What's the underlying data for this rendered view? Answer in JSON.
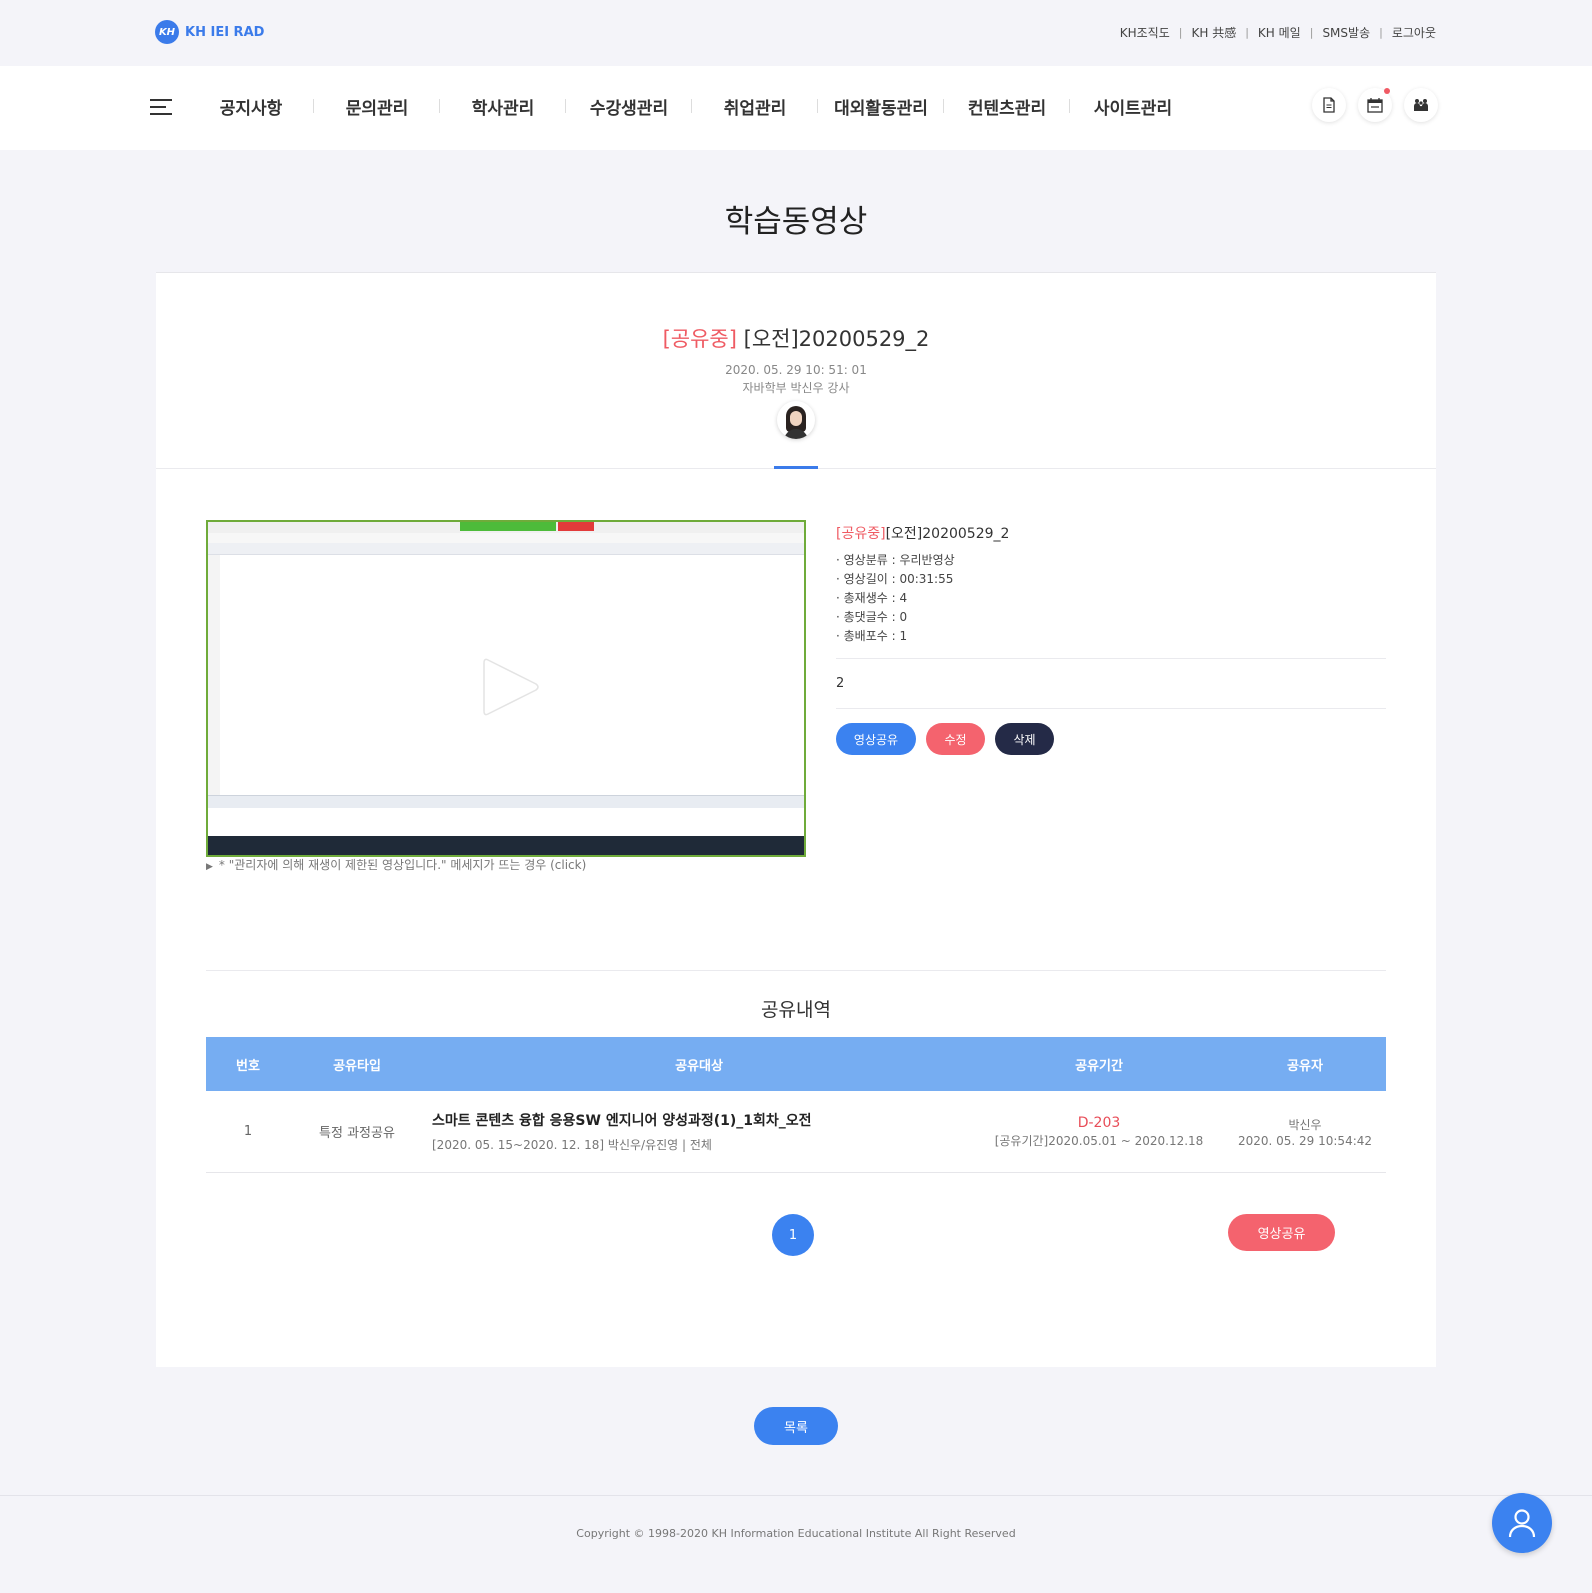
{
  "brand": {
    "logo_mark": "KH",
    "logo_text": "KH IEI RAD",
    "accent": "#3b7bea"
  },
  "util_links": [
    "KH조직도",
    "KH 共感",
    "KH 메일",
    "SMS발송",
    "로그아웃"
  ],
  "nav": {
    "menu": [
      "공지사항",
      "문의관리",
      "학사관리",
      "수강생관리",
      "취업관리",
      "대외활동관리",
      "컨텐츠관리",
      "사이트관리"
    ],
    "icons": [
      "document-icon",
      "calendar-icon",
      "people-icon"
    ]
  },
  "page": {
    "title": "학습동영상"
  },
  "video": {
    "status_tag": "[공유중]",
    "title": "[오전]20200529_2",
    "datetime": "2020. 05. 29 10: 51: 01",
    "author": "자바학부 박신우 강사",
    "restrict_note": "* \"관리자에 의해 재생이 제한된 영상입니다.\" 메세지가 뜨는 경우 (click)"
  },
  "info": {
    "status_tag": "[공유중]",
    "title": "[오전]20200529_2",
    "details": [
      "· 영상분류 : 우리반영상",
      "· 영상길이 : 00:31:55",
      "· 총재생수 : 4",
      "· 총댓글수 : 0",
      "· 총배포수 : 1"
    ],
    "description": "2",
    "buttons": {
      "share": "영상공유",
      "edit": "수정",
      "delete": "삭제"
    }
  },
  "share_history": {
    "title": "공유내역",
    "columns": [
      "번호",
      "공유타입",
      "공유대상",
      "공유기간",
      "공유자"
    ],
    "rows": [
      {
        "no": "1",
        "type": "특정 과정공유",
        "target_main": "스마트 콘텐츠 융합 응용SW 엔지니어 양성과정(1)_1회차_오전",
        "target_sub": "[2020. 05. 15~2020. 12. 18] 박신우/유진영 | 전체",
        "dday": "D-203",
        "period": "[공유기간]2020.05.01 ~ 2020.12.18",
        "sharer": "박신우",
        "shared_at": "2020. 05. 29 10:54:42"
      }
    ],
    "pagination": {
      "current": "1"
    },
    "share_button": "영상공유"
  },
  "list_button": "목록",
  "footer": {
    "copyright": "Copyright © 1998-2020 KH Information Educational Institute All Right Reserved"
  },
  "colors": {
    "primary": "#3b82f0",
    "danger": "#f4636e",
    "dark": "#242a47",
    "table_header": "#76adf2",
    "shared_tag": "#ef5b63"
  }
}
